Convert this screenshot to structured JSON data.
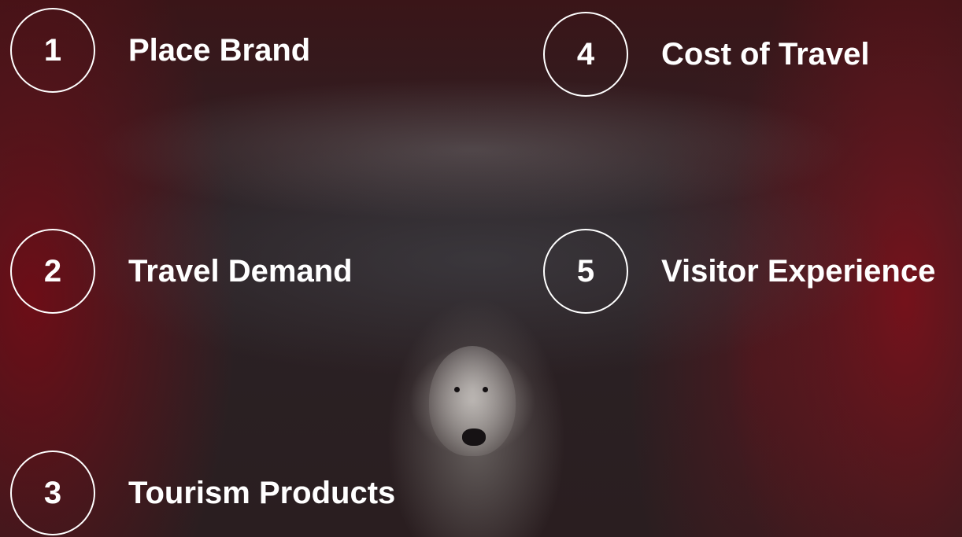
{
  "items": [
    {
      "number": "1",
      "label": "Place Brand"
    },
    {
      "number": "2",
      "label": "Travel Demand"
    },
    {
      "number": "3",
      "label": "Tourism Products"
    },
    {
      "number": "4",
      "label": "Cost of Travel"
    },
    {
      "number": "5",
      "label": "Visitor Experience"
    }
  ],
  "background": {
    "image": "polar-bear-photo",
    "tint": "#2a1e20",
    "accent": "#8a0f1c"
  },
  "colors": {
    "text": "#ffffff",
    "circle_border": "#ffffff"
  }
}
